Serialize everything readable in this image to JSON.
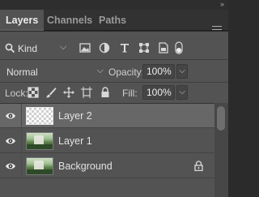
{
  "panel": {
    "collapse_glyph": "»",
    "tabs": [
      {
        "label": "Layers",
        "active": true
      },
      {
        "label": "Channels",
        "active": false
      },
      {
        "label": "Paths",
        "active": false
      }
    ]
  },
  "filter": {
    "kind_label": "Kind",
    "icons": [
      "pixel-filter-icon",
      "adjustment-filter-icon",
      "type-filter-icon",
      "shape-filter-icon",
      "smart-object-filter-icon",
      "filter-toggle-icon"
    ]
  },
  "blend": {
    "mode": "Normal",
    "opacity_label": "Opacity:",
    "opacity_value": "100%"
  },
  "lock": {
    "label": "Lock:",
    "fill_label": "Fill:",
    "fill_value": "100%",
    "icons": [
      "lock-transparent-pixels-icon",
      "lock-image-pixels-icon",
      "lock-position-icon",
      "lock-artboard-icon",
      "lock-all-icon"
    ]
  },
  "layers": [
    {
      "name": "Layer 2",
      "selected": true,
      "visible": true,
      "thumbnail": "transparent",
      "locked": false
    },
    {
      "name": "Layer 1",
      "selected": false,
      "visible": true,
      "thumbnail": "photo",
      "locked": false
    },
    {
      "name": "Background",
      "selected": false,
      "visible": true,
      "thumbnail": "photo",
      "locked": true
    }
  ],
  "colors": {
    "panel_bg": "#535353",
    "selected_row": "#676767",
    "tab_bar": "#323232"
  }
}
